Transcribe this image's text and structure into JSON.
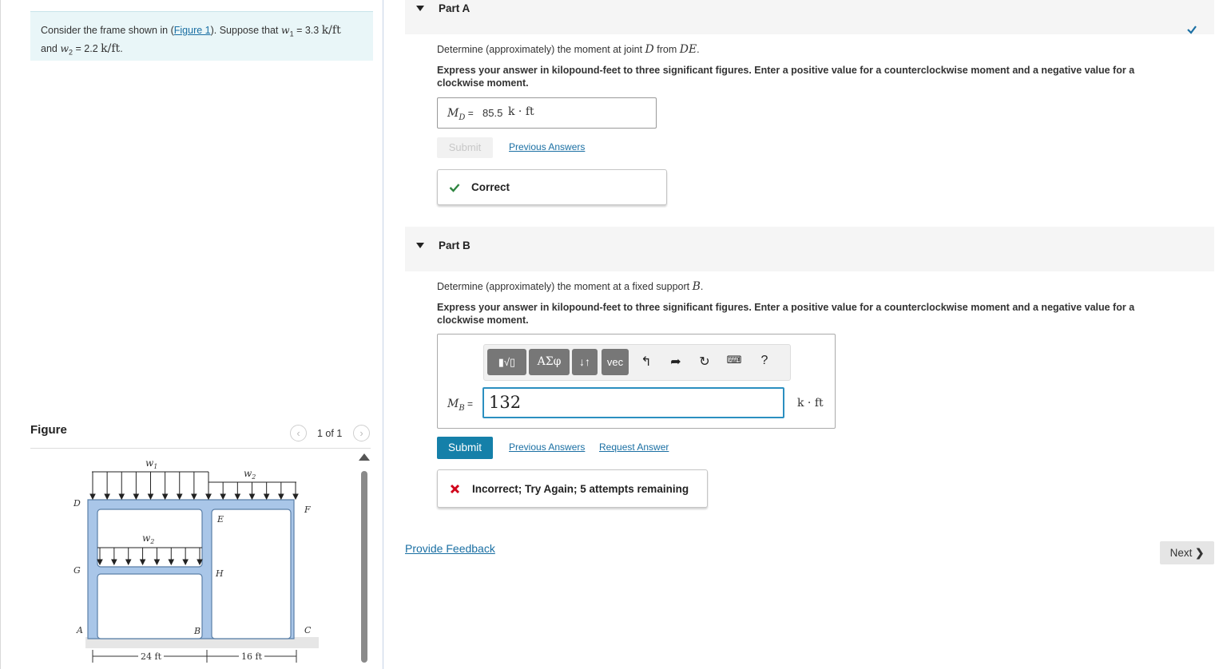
{
  "problem": {
    "text_before": "Consider the frame shown in (",
    "figure_link": "Figure 1",
    "text_mid": "). Suppose that ",
    "w1_sym": "w",
    "w1_sub": "1",
    "w1_eq": " = 3.3 ",
    "w1_unit": "k/ft",
    "line2_and": "and ",
    "w2_sym": "w",
    "w2_sub": "2",
    "w2_eq": " = 2.2 ",
    "w2_unit": "k/ft",
    "w2_end": "."
  },
  "figure": {
    "heading": "Figure",
    "page_counter": "1 of 1",
    "prev_icon": "chevron-left-icon",
    "next_icon": "chevron-right-icon",
    "labels": {
      "w1": "w",
      "w1_sub": "1",
      "w2_top": "w",
      "w2_top_sub": "2",
      "w2_inner": "w",
      "w2_inner_sub": "2",
      "D": "D",
      "E": "E",
      "F": "F",
      "G": "G",
      "H": "H",
      "A": "A",
      "B": "B",
      "C": "C",
      "dim1": "24 ft",
      "dim2": "16 ft"
    },
    "colors": {
      "frame_fill": "#a9c6e8",
      "frame_stroke": "#5a7fa8",
      "ground": "#e0e0e0"
    }
  },
  "partA": {
    "title": "Part A",
    "question_pre": "Determine (approximately) the moment at joint ",
    "question_var": "D",
    "question_mid": " from ",
    "question_var2": "DE",
    "question_end": ".",
    "instructions": "Express your answer in kilopound-feet to three significant figures. Enter a positive value for a counterclockwise moment and a negative value for a clockwise moment.",
    "answer_label": "M",
    "answer_label_sub": "D",
    "answer_eq": " = ",
    "answer_value": "85.5",
    "answer_unit": "k · ft",
    "submit_label": "Submit",
    "previous_answers": "Previous Answers",
    "feedback": "Correct",
    "status_color": "#2e8540"
  },
  "partB": {
    "title": "Part B",
    "question_pre": "Determine (approximately) the moment at a fixed support ",
    "question_var": "B",
    "question_end": ".",
    "instructions": "Express your answer in kilopound-feet to three significant figures. Enter a positive value for a counterclockwise moment and a negative value for a clockwise moment.",
    "toolbar": {
      "templates": "▮√▯",
      "greek": "ΑΣφ",
      "arrows": "↓↑",
      "vec": "vec",
      "undo_icon": "undo-icon",
      "redo_icon": "redo-icon",
      "reset_icon": "reset-icon",
      "keyboard_icon": "keyboard-icon",
      "help": "?"
    },
    "answer_label": "M",
    "answer_label_sub": "B",
    "answer_eq": " = ",
    "answer_value": "132",
    "answer_unit": "k · ft",
    "submit_label": "Submit",
    "previous_answers": "Previous Answers",
    "request_answer": "Request Answer",
    "feedback": "Incorrect; Try Again; 5 attempts remaining",
    "status_color": "#d0021b"
  },
  "footer": {
    "provide_feedback": "Provide Feedback",
    "next_label": "Next"
  }
}
